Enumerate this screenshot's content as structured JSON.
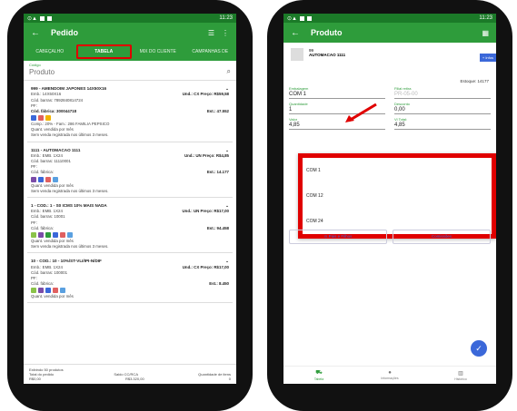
{
  "left": {
    "status": {
      "time": "11:23"
    },
    "appbar": {
      "title": "Pedido"
    },
    "tabs": [
      {
        "label": "CABEÇALHO"
      },
      {
        "label": "TABELA"
      },
      {
        "label": "MIX DO CLIENTE"
      },
      {
        "label": "CAMPANHAS DE"
      }
    ],
    "search": {
      "label": "Código",
      "placeholder": "Produto"
    },
    "products": [
      {
        "name": "999 - AMENDOIM JAPONES 14X50X16",
        "emb": "Emb.: 14X50X16",
        "barcode": "Cód. barras: 7892840814724",
        "pf": "PF:",
        "fab": "Cód. fábrica: 300044718",
        "und": "Und.: CX Preço: R$59,58",
        "est": "Est.: 47.552",
        "extra": "Comp.: 20% - Fam.: 286 FAMILIA PEPSICO",
        "q1": "Quant. vendida por mês",
        "q2": "Sem venda registrada nos últimos 3 meses."
      },
      {
        "name": "1111 - AUTOMACAO 1111",
        "emb": "Emb.: EMB. 1X24",
        "barcode": "Cód. barras: 11110001",
        "pf": "PF:",
        "fab": "Cód. fábrica:",
        "und": "Und.: UN Preço: R$4,85",
        "est": "Est.: 14.177",
        "q1": "Quant. vendida por mês",
        "q2": "Sem venda registrada nos últimos 3 meses."
      },
      {
        "name": "1 - COD.: 1 - S0 ICMS 10% MAIS NADA",
        "emb": "Emb.: EMB. 1X24",
        "barcode": "Cód. barras: 10001",
        "pf": "PF:",
        "fab": "Cód. fábrica:",
        "und": "Und.: UN Preço: R$17,00",
        "est": "Est.: 94.458",
        "q1": "Quant. vendida por mês",
        "q2": "Sem venda registrada nos últimos 3 meses."
      },
      {
        "name": "10 - COD.: 10 - 10%/ST-VLI/IPI-N/DIF",
        "emb": "Emb.: EMB. 1X24",
        "barcode": "Cód. barras: 100001",
        "pf": "PF:",
        "fab": "Cód. fábrica:",
        "und": "Und.: CX Preço: R$17,00",
        "est": "Est.: 8.450",
        "q1": "Quant. vendida por mês"
      }
    ],
    "footer": {
      "exibindo": "Exibindo 50 produtos",
      "total": "Total do pedido",
      "saldo": "Saldo CC/RCA",
      "qtd": "Quantidade de itens",
      "total_v": "R$0,00",
      "saldo_v": "R$3.320,00",
      "qtd_v": "0"
    }
  },
  "right": {
    "status": {
      "time": "11:23"
    },
    "appbar": {
      "title": "Produto"
    },
    "product": {
      "code": "99",
      "name": "AUTOMACAO 1111"
    },
    "infos": "+ Infos",
    "estoque": "Estoque: 14177",
    "fields": {
      "embalagem_label": "Embalagem",
      "embalagem_value": "COM 1",
      "filial_label": "Filial retira",
      "filial_value": "PR-05-00",
      "quantidade_label": "Quantidade",
      "quantidade_value": "1",
      "desconto_label": "Desconto",
      "desconto_value": "0,00",
      "valor_label": "Valor",
      "valor_value": "4,85",
      "vltotal_label": "Vl Total:",
      "vltotal_value": "4,85"
    },
    "dropdown": [
      "COM 1",
      "COM 12",
      "COM 24"
    ],
    "buttons": {
      "pais": "Pais e Filhos",
      "comissoes": "Comissões"
    },
    "nav": [
      {
        "label": "Tabela"
      },
      {
        "label": "Informações"
      },
      {
        "label": "Histórico"
      }
    ],
    "colors": {
      "green": "#2e9c3b",
      "red": "#e00000",
      "blue": "#3b68d9"
    }
  }
}
